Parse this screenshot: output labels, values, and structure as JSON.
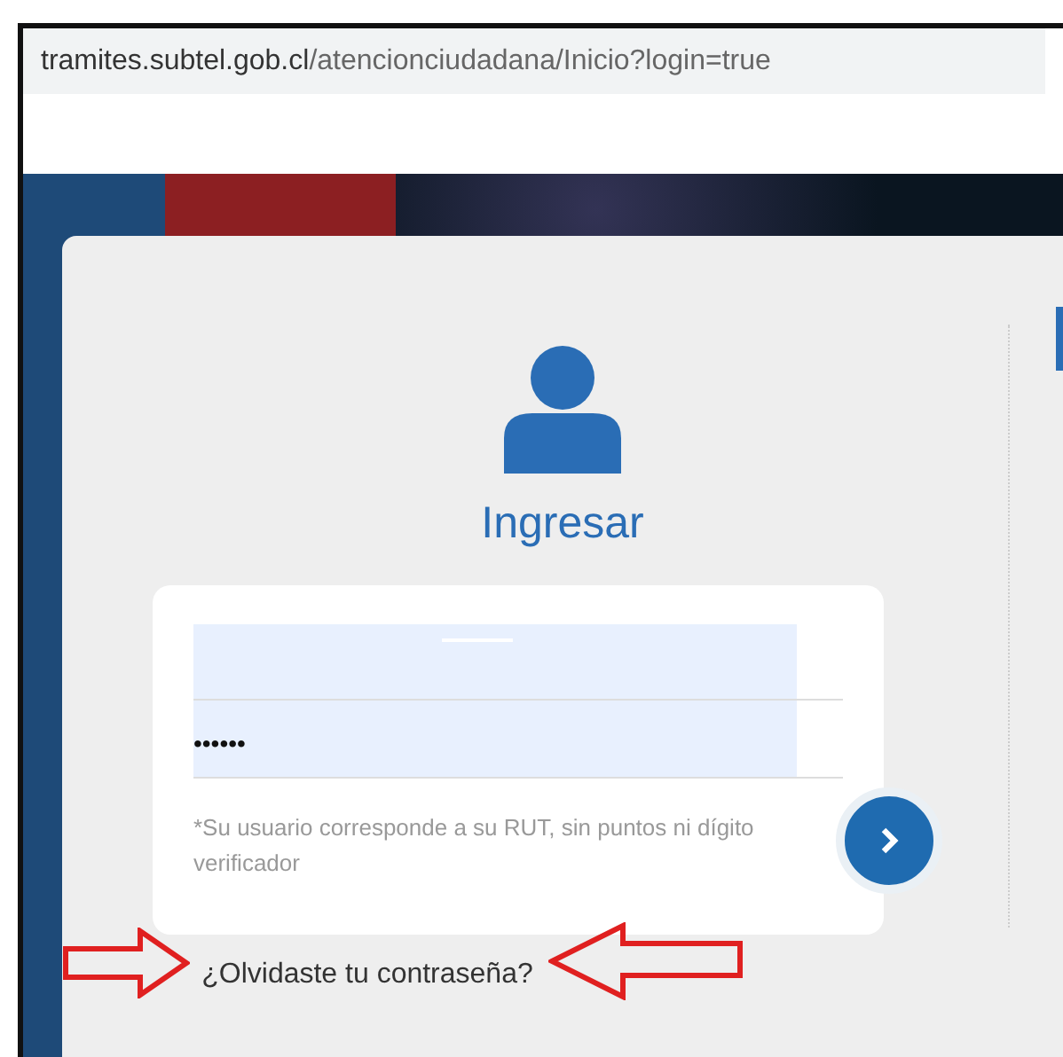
{
  "address_bar": {
    "host": "tramites.subtel.gob.cl",
    "path": "/atencionciudadana/Inicio?login=true"
  },
  "login": {
    "title": "Ingresar",
    "password": {
      "value": "••••••"
    },
    "hint": "*Su usuario corresponde a su RUT, sin puntos ni dígito verificador",
    "forgot_link": "¿Olvidaste tu contraseña?"
  }
}
